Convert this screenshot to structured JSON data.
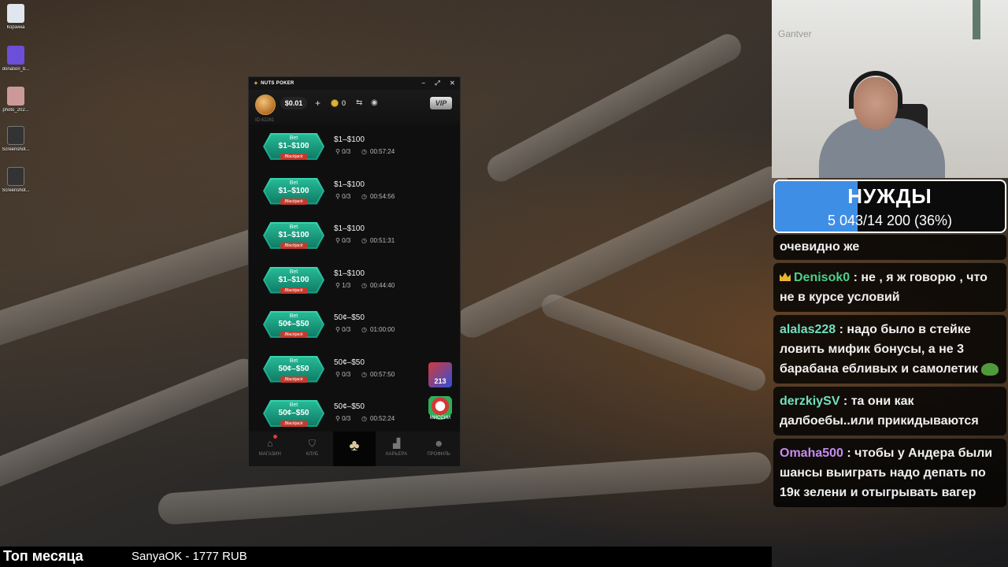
{
  "desktop": {
    "icons": [
      {
        "label": "Корзина",
        "icon": "recycle-bin-icon"
      },
      {
        "label": "donation_b...",
        "icon": "file-icon"
      },
      {
        "label": "photo_202...",
        "icon": "image-icon"
      },
      {
        "label": "Screenshot...",
        "icon": "image-icon"
      },
      {
        "label": "Screenshot...",
        "icon": "image-icon"
      }
    ]
  },
  "poker": {
    "app_title": "NUTS POKER",
    "balance": "$0.01",
    "coins": "0",
    "vip_label": "VIP",
    "user_id": "ID:42261",
    "tables": [
      {
        "badge_top": "Bet",
        "badge_stakes": "$1–$100",
        "game": "Blackjack",
        "stakes": "$1–$100",
        "players": "0/3",
        "time": "00:57:24"
      },
      {
        "badge_top": "Bet",
        "badge_stakes": "$1–$100",
        "game": "Blackjack",
        "stakes": "$1–$100",
        "players": "0/3",
        "time": "00:54:56"
      },
      {
        "badge_top": "Bet",
        "badge_stakes": "$1–$100",
        "game": "Blackjack",
        "stakes": "$1–$100",
        "players": "0/3",
        "time": "00:51:31"
      },
      {
        "badge_top": "Bet",
        "badge_stakes": "$1–$100",
        "game": "Blackjack",
        "stakes": "$1–$100",
        "players": "1/3",
        "time": "00:44:40"
      },
      {
        "badge_top": "Bet",
        "badge_stakes": "50¢–$50",
        "game": "Blackjack",
        "stakes": "50¢–$50",
        "players": "0/3",
        "time": "01:00:00"
      },
      {
        "badge_top": "Bet",
        "badge_stakes": "50¢–$50",
        "game": "Blackjack",
        "stakes": "50¢–$50",
        "players": "0/3",
        "time": "00:57:50"
      },
      {
        "badge_top": "Bet",
        "badge_stakes": "50¢–$50",
        "game": "Blackjack",
        "stakes": "50¢–$50",
        "players": "0/3",
        "time": "00:52:24"
      }
    ],
    "promos": {
      "first": "213",
      "second": "МИССИИ"
    },
    "nav": [
      {
        "label": "МАГАЗИН",
        "icon": "shop-icon"
      },
      {
        "label": "КЛУБ",
        "icon": "club-shield-icon"
      },
      {
        "label": "",
        "icon": "acorn-icon"
      },
      {
        "label": "КАРЬЕРА",
        "icon": "career-chart-icon"
      },
      {
        "label": "ПРОФИЛЬ",
        "icon": "profile-icon"
      }
    ]
  },
  "webcam": {
    "wall_text": "Gantver"
  },
  "goal": {
    "title": "НУЖДЫ",
    "progress_text": "5 043/14 200 (36%)",
    "fraction": 0.36,
    "fill_color": "#3f8ee6"
  },
  "chat": {
    "messages": [
      {
        "author": "",
        "author_color": "#ffffff",
        "text": "очевидно же"
      },
      {
        "author": "Denisok0",
        "author_color": "#4bd08a",
        "badge": "crown-icon",
        "text": " : не , я ж говорю , что не в курсе условий"
      },
      {
        "author": "alalas228",
        "author_color": "#6fe0c0",
        "text": " : надо было в стейке ловить мифик бонусы, а не 3 барабана ебливых и самолетик",
        "emote": "pepe-emote"
      },
      {
        "author": "derzkiySV",
        "author_color": "#6fe0c0",
        "text": " : та они как далбоебы..или прикидываются"
      },
      {
        "author": "Omaha500",
        "author_color": "#c48cf0",
        "text": " : чтобы у Андера были шансы выиграть надо депать по 19к зелени и отыгрывать вагер"
      }
    ]
  },
  "bottom_bar": {
    "title": "Топ месяца",
    "donor": "SanyaOK - 1777 RUB"
  }
}
